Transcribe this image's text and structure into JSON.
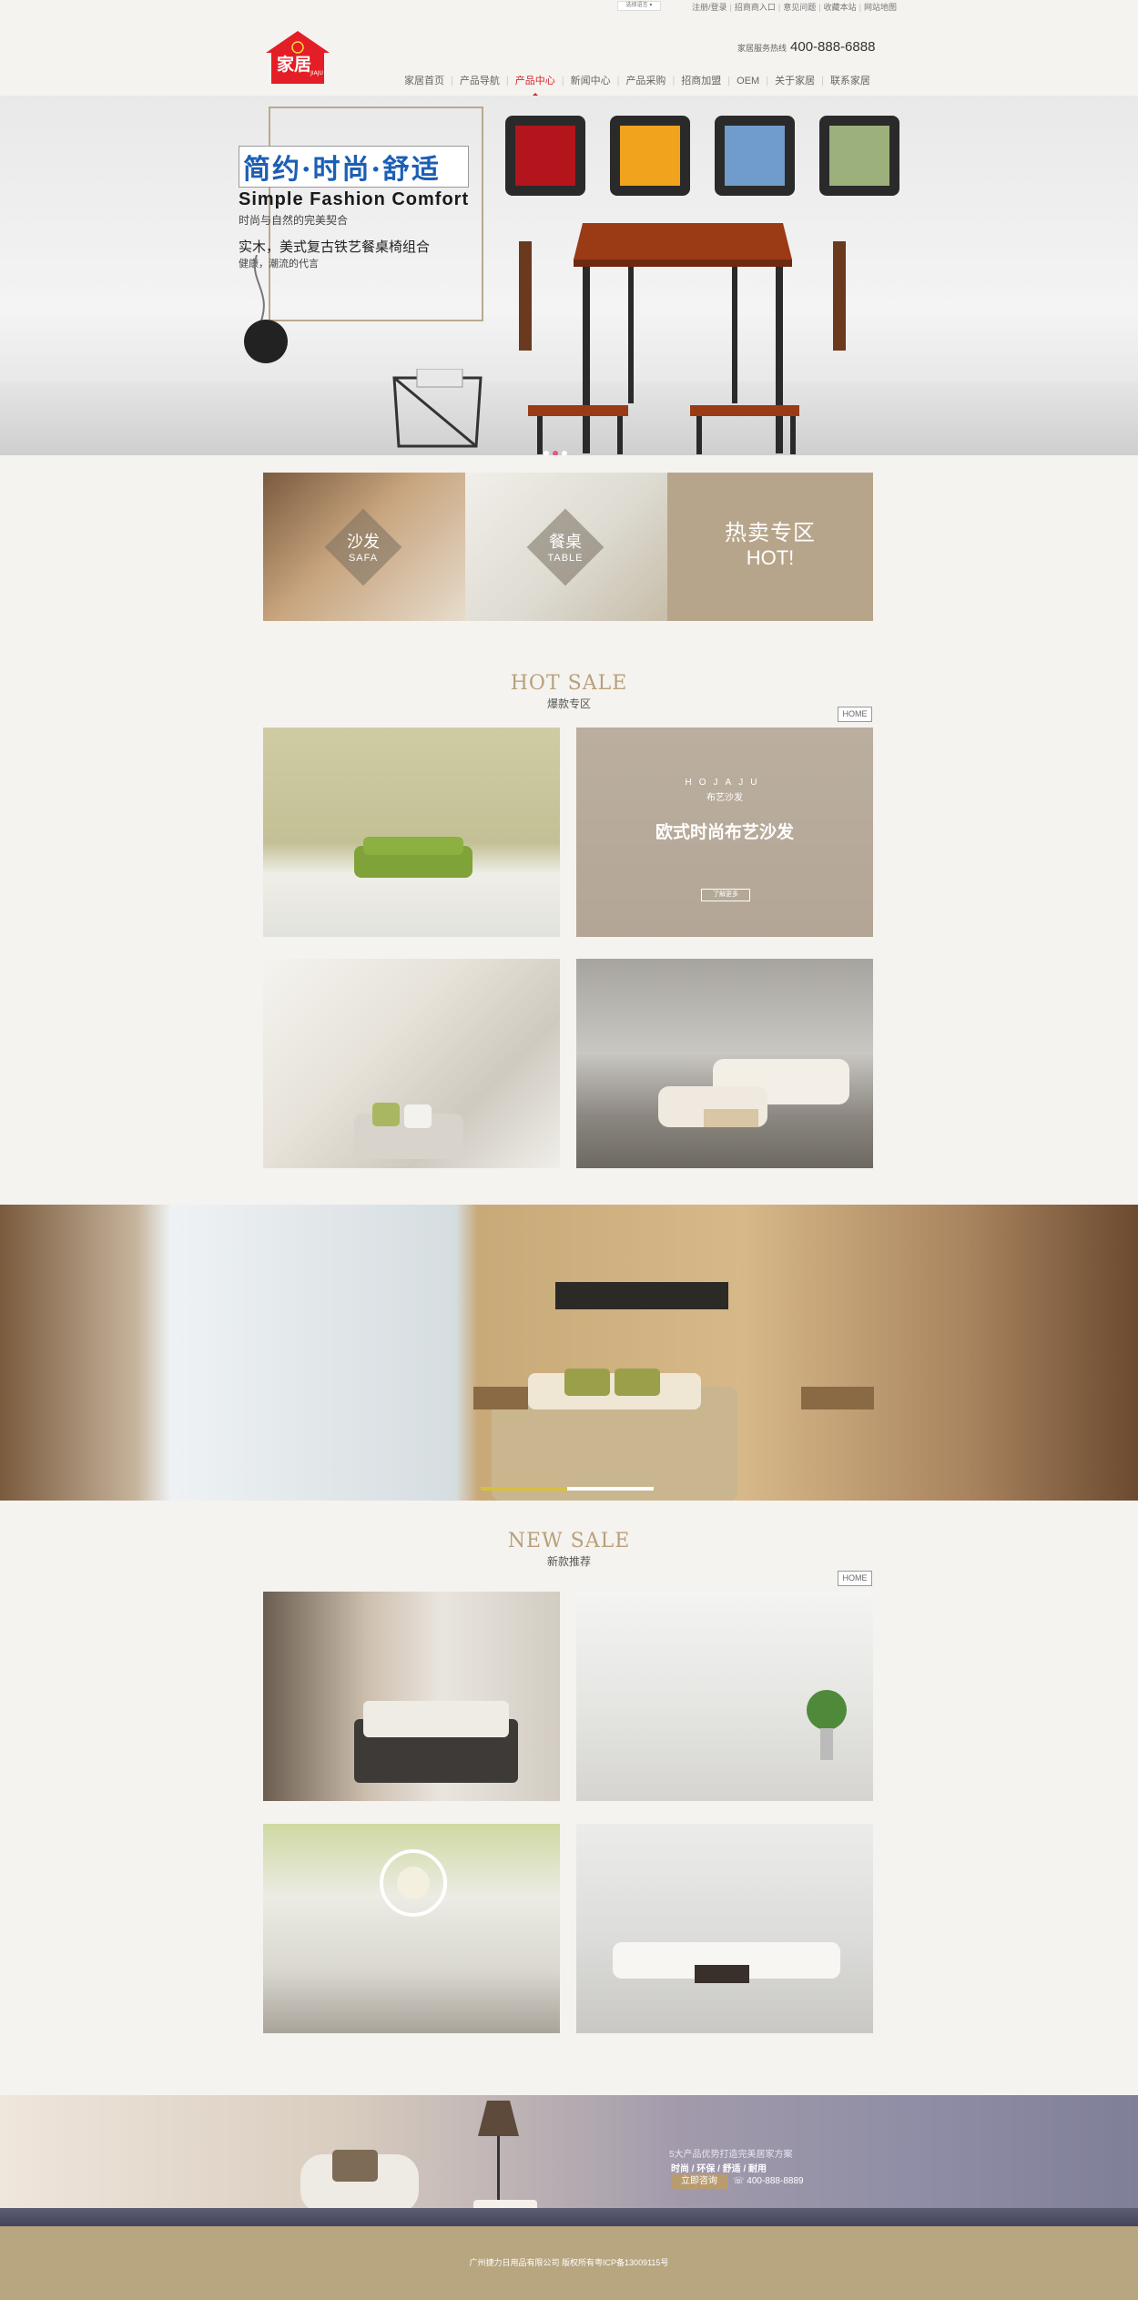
{
  "top_bar": {
    "language_select": "选择语言",
    "links": [
      "注册/登录",
      "招商商入口",
      "意见问题",
      "收藏本站",
      "网站地图"
    ]
  },
  "header": {
    "logo_text": "家居",
    "hotline_label": "家居服务热线",
    "hotline_number": "400-888-6888",
    "nav": [
      {
        "label": "家居首页",
        "active": false
      },
      {
        "label": "产品导航",
        "active": false
      },
      {
        "label": "产品中心",
        "active": true
      },
      {
        "label": "新闻中心",
        "active": false
      },
      {
        "label": "产品采购",
        "active": false
      },
      {
        "label": "招商加盟",
        "active": false
      },
      {
        "label": "OEM",
        "active": false
      },
      {
        "label": "关于家居",
        "active": false
      },
      {
        "label": "联系家居",
        "active": false
      }
    ]
  },
  "hero": {
    "slogan_cn": "简约·时尚·舒适",
    "slogan_en": "Simple Fashion Comfort",
    "line1": "时尚与自然的完美契合",
    "line2": "实木，美式复古铁艺餐桌椅组合",
    "line3": "健康，潮流的代言"
  },
  "promo": {
    "sofa_cn": "沙发",
    "sofa_en": "SAFA",
    "table_cn": "餐桌",
    "table_en": "TABLE",
    "hot_cn": "热卖专区",
    "hot_en": "HOT!"
  },
  "hot_sale": {
    "title_en": "HOT SALE",
    "title_cn": "爆款专区",
    "home_btn": "HOME",
    "feature": {
      "brand": "HOJAJU",
      "sub": "布艺沙发",
      "title": "欧式时尚布艺沙发",
      "btn": "了解更多"
    }
  },
  "new_sale": {
    "title_en": "NEW SALE",
    "title_cn": "新款推荐",
    "home_btn": "HOME"
  },
  "cta": {
    "line1": "5大产品优势打造完美居家方案",
    "line2": "时尚 / 环保 / 舒适 / 耐用",
    "button": "立即咨询",
    "phone": "400-888-8889"
  },
  "footer": {
    "copyright": "广州捷力日用品有限公司 版权所有粤ICP备13009115号"
  },
  "banner_progress": 0.5
}
